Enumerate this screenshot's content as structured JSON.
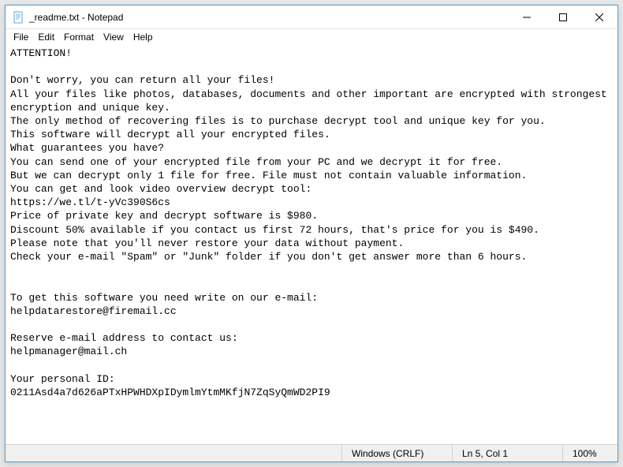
{
  "titlebar": {
    "title": "_readme.txt - Notepad"
  },
  "menubar": {
    "items": [
      "File",
      "Edit",
      "Format",
      "View",
      "Help"
    ]
  },
  "content": {
    "text": "ATTENTION!\n\nDon't worry, you can return all your files!\nAll your files like photos, databases, documents and other important are encrypted with strongest encryption and unique key.\nThe only method of recovering files is to purchase decrypt tool and unique key for you.\nThis software will decrypt all your encrypted files.\nWhat guarantees you have?\nYou can send one of your encrypted file from your PC and we decrypt it for free.\nBut we can decrypt only 1 file for free. File must not contain valuable information.\nYou can get and look video overview decrypt tool:\nhttps://we.tl/t-yVc390S6cs\nPrice of private key and decrypt software is $980.\nDiscount 50% available if you contact us first 72 hours, that's price for you is $490.\nPlease note that you'll never restore your data without payment.\nCheck your e-mail \"Spam\" or \"Junk\" folder if you don't get answer more than 6 hours.\n\n\nTo get this software you need write on our e-mail:\nhelpdatarestore@firemail.cc\n\nReserve e-mail address to contact us:\nhelpmanager@mail.ch\n\nYour personal ID:\n0211Asd4a7d626aPTxHPWHDXpIDymlmYtmMKfjN7ZqSyQmWD2PI9"
  },
  "statusbar": {
    "encoding": "Windows (CRLF)",
    "position": "Ln 5, Col 1",
    "zoom": "100%"
  }
}
